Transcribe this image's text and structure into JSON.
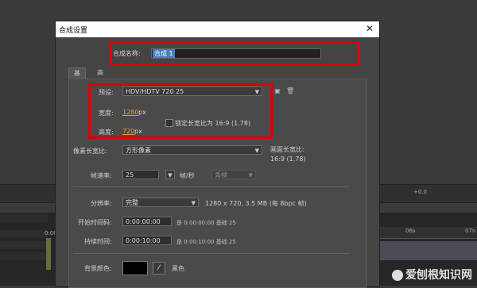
{
  "dialog": {
    "title": "合成设置",
    "close_glyph": "✕",
    "comp_name_label": "合成名称:",
    "comp_name_value": "合成 1",
    "tabs": [
      "基本",
      "高级"
    ],
    "preset_label": "预设:",
    "preset_value": "HDV/HDTV 720 25",
    "width_label": "宽度:",
    "width_value": "1280",
    "width_unit": "px",
    "height_label": "高度:",
    "height_value": "720",
    "height_unit": "px",
    "lock_label": "锁定长宽比为 16:9 (1.78)",
    "par_label": "像素长宽比:",
    "par_value": "方形像素",
    "frame_aspect_label": "画面长宽比:",
    "frame_aspect_value": "16:9 (1.78)",
    "fps_label": "帧速率:",
    "fps_value": "25",
    "fps_unit": "帧/秒",
    "drop_frame_value": "丢帧",
    "resolution_label": "分辨率:",
    "resolution_value": "完整",
    "resolution_info": "1280 x 720, 3.5 MB (每 8bpc 帧)",
    "start_tc_label": "开始时间码:",
    "start_tc_value": "0:00:00:00",
    "start_tc_info": "是 0:00:00:00 基础 25",
    "duration_label": "持续时间:",
    "duration_value": "0:00:10:00",
    "duration_info": "是 0:00:10:00 基础 25",
    "bg_color_label": "背景颜色:",
    "bg_color_name": "黑色",
    "bg_color_hex": "#000000"
  },
  "background": {
    "ruler_labels": [
      "06s",
      "07s"
    ],
    "toolbar_value": "+0.0",
    "left_time": "0:00"
  },
  "watermark": "爱刨根知识网"
}
